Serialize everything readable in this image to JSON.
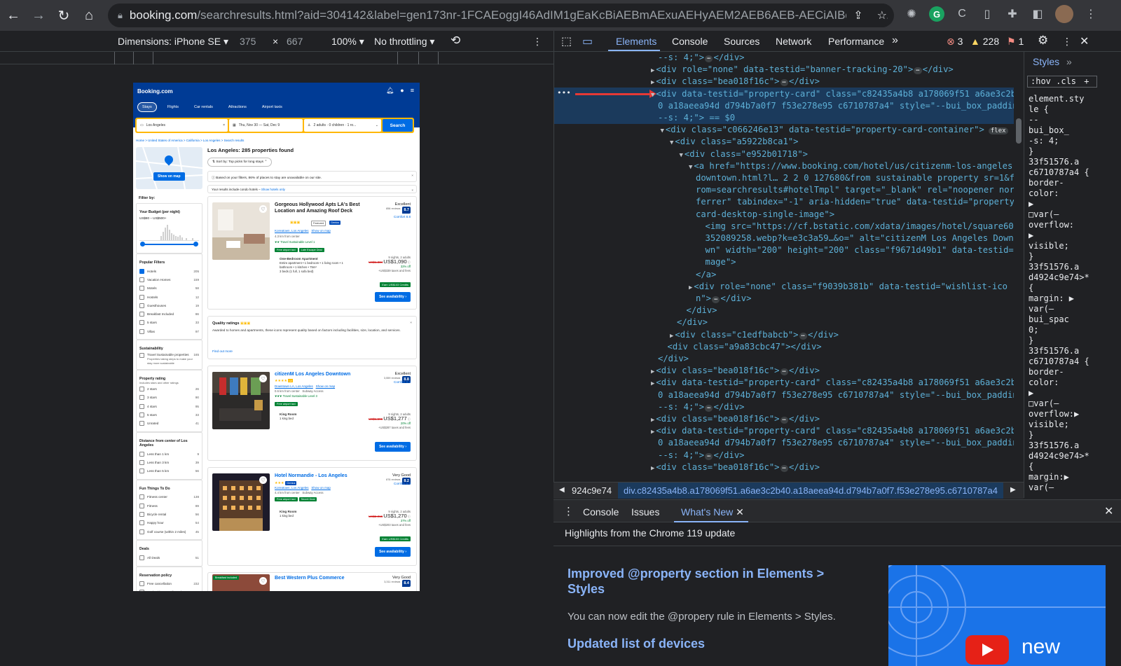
{
  "browser": {
    "url_host": "booking.com",
    "url_path": "/searchresults.html?aid=304142&label=gen173nr-1FCAEoggI46AdIM1gEaKcBiAEBmAExuAEHyAEM2AEB6AEB-AECiAIBqAIDu...",
    "ext_badge_letter": "G"
  },
  "device_toolbar": {
    "dimensions_label": "Dimensions: iPhone SE",
    "width": "375",
    "times": "×",
    "height": "667",
    "zoom": "100%",
    "throttling": "No throttling"
  },
  "booking": {
    "logo": "Booking.com",
    "tabs": [
      "Stays",
      "Flights",
      "Car rentals",
      "Attractions",
      "Airport taxis"
    ],
    "search": {
      "destination": "Los Angeles",
      "dates": "Thu, Nov 30 — Sat, Dec 9",
      "guests": "2 adults · 0 children · 1 ro...",
      "button": "Search"
    },
    "breadcrumbs": "Home > United States of America > California > Los Angeles > Search results",
    "show_on_map": "Show on map",
    "results_title": "Los Angeles: 285 properties found",
    "sort_label": "Sort by: Top picks for long stays",
    "notice": "Based on your filters, 86% of places to stay are unavailable on our site.",
    "notice2_text": "Your results include condo hotels –",
    "notice2_link": "Show hotels only",
    "filter_by": "Filter by:",
    "budget_title": "Your Budget (per night)",
    "budget_range": "US$80 – US$500+",
    "popular_title": "Popular Filters",
    "popular": [
      {
        "label": "Hotels",
        "count": "205",
        "on": true
      },
      {
        "label": "Vacation Homes",
        "count": "159",
        "on": false
      },
      {
        "label": "Motels",
        "count": "58",
        "on": false
      },
      {
        "label": "Hostels",
        "count": "12",
        "on": false
      },
      {
        "label": "Guesthouses",
        "count": "19",
        "on": false
      },
      {
        "label": "Breakfast Included",
        "count": "86",
        "on": false
      },
      {
        "label": "5 stars",
        "count": "33",
        "on": false
      },
      {
        "label": "Villas",
        "count": "97",
        "on": false
      }
    ],
    "sustain_title": "Sustainability",
    "sustain_label": "Travel Sustainable properties",
    "sustain_count": "165",
    "sustain_note": "Properties taking steps to make your stay more sustainable",
    "rating_title": "Property rating",
    "rating_note": "Includes stars and other ratings",
    "ratings": [
      {
        "label": "2 stars",
        "count": "26"
      },
      {
        "label": "3 stars",
        "count": "90"
      },
      {
        "label": "4 stars",
        "count": "95"
      },
      {
        "label": "5 stars",
        "count": "33"
      },
      {
        "label": "Unrated",
        "count": "41"
      }
    ],
    "distance_title": "Distance from center of Los Angeles",
    "distances": [
      {
        "label": "Less than 1 km",
        "count": "9"
      },
      {
        "label": "Less than 3 km",
        "count": "39"
      },
      {
        "label": "Less than 5 km",
        "count": "56"
      }
    ],
    "fun_title": "Fun Things To Do",
    "fun": [
      {
        "label": "Fitness center",
        "count": "138"
      },
      {
        "label": "Fitness",
        "count": "89"
      },
      {
        "label": "Bicycle rental",
        "count": "56"
      },
      {
        "label": "Happy hour",
        "count": "54"
      },
      {
        "label": "Golf course (within 2 miles)",
        "count": "45"
      }
    ],
    "deals_title": "Deals",
    "deals": [
      {
        "label": "All Deals",
        "count": "51"
      }
    ],
    "policy_title": "Reservation policy",
    "policy": [
      {
        "label": "Free cancellation",
        "count": "232"
      },
      {
        "label": "Book without credit card",
        "count": "1"
      }
    ],
    "quality": {
      "title": "Quality ratings",
      "body": "Awarded to homes and apartments, these icons represent quality based on factors including facilities, size, location, and services.",
      "link": "Find out more"
    },
    "cards": [
      {
        "name": "Gorgeous Hollywood Apts LA's Best Location and Amazing Roof Deck",
        "badges": "Featured",
        "location": "Koreatown, Los Angeles",
        "show_map": "Show on map",
        "distance": "4.3 km from center",
        "eco": "Travel Sustainable Level 1",
        "tags": [
          "Free airport taxi",
          "Late Escape Deal"
        ],
        "score_word": "Excellent",
        "reviews": "856 reviews",
        "score": "8.7",
        "comfort": "Comfort 8.8",
        "room_title": "One-Bedroom Apartment",
        "room_desc": "Entire apartment • 1 bedroom • 1 living room • 1 bathroom • 1 kitchen • 75m²",
        "room_beds": "3 beds (1 full, 1 sofa bed)",
        "nights": "9 nights, 2 adults",
        "old_price": "US$1,334",
        "price": "US$1,090",
        "discount": "32% off",
        "taxes": "+US$339 taxes and fees",
        "credit": "Earn US$103 Credits",
        "cta": "See availability"
      },
      {
        "name": "citizenM Los Angeles Downtown",
        "badges": "",
        "location": "Downtown LA, Los Angeles",
        "show_map": "Show on map",
        "distance": "0.6 km from center",
        "subway": "Subway Access",
        "eco": "Travel Sustainable Level 3",
        "tags": [
          "Free airport taxi"
        ],
        "score_word": "Excellent",
        "reviews": "3,559 reviews",
        "score": "8.8",
        "comfort": "Comfort 9.2",
        "room_title": "King Room",
        "room_desc": "1 king bed",
        "nights": "9 nights, 2 adults",
        "old_price": "US$1,596",
        "price": "US$1,277",
        "discount": "20% off",
        "taxes": "+US$287 taxes and fees",
        "credit": "",
        "cta": "See availability"
      },
      {
        "name": "Hotel Normandie - Los Angeles",
        "badges": "Genius",
        "location": "Koreatown, Los Angeles",
        "show_map": "Show on map",
        "distance": "4.4 km from center",
        "subway": "Subway Access",
        "eco": "",
        "tags": [
          "Free airport taxi",
          "Secret Deal"
        ],
        "score_word": "Very Good",
        "reviews": "876 reviews",
        "score": "8.2",
        "comfort": "Comfort 8.5",
        "room_title": "King Room",
        "room_desc": "1 king bed",
        "nights": "9 nights, 2 adults",
        "old_price": "US$2,016",
        "price": "US$1,270",
        "discount": "37% off",
        "taxes": "+US$203 taxes and fees",
        "credit": "Earn US$103 Credits",
        "cta": "See availability"
      },
      {
        "name": "Best Western Plus Commerce",
        "score_word": "Very Good",
        "reviews": "3,311 reviews",
        "score": "8.4",
        "tag_img": "Breakfast included"
      }
    ]
  },
  "devtools": {
    "tabs": [
      "Elements",
      "Console",
      "Sources",
      "Network",
      "Performance"
    ],
    "more": "»",
    "errors": "3",
    "warnings": "228",
    "issues": "1",
    "dom_lines": [
      {
        "indent": 0,
        "arrow": "",
        "html": "--s: 4;\">",
        "tail": "</div>"
      },
      {
        "indent": 0,
        "arrow": "▶",
        "open": "<div role=\"none\" data-testid=\"banner-tracking-20\">",
        "tail": "</div>"
      },
      {
        "indent": 0,
        "arrow": "▶",
        "open": "<div class=\"bea018f16c\">",
        "tail": "</div>"
      },
      {
        "indent": 0,
        "arrow": "▼",
        "open": "<div data-testid=\"property-card\" class=\"c82435a4b8 a178069f51 a6ae3c2b4",
        "tail": ""
      },
      {
        "indent": 0,
        "arrow": "",
        "open": "0 a18aeea94d d794b7a0f7 f53e278e95 c6710787a4\" style=\"--bui_box_padding",
        "tail": ""
      },
      {
        "indent": 0,
        "arrow": "",
        "open": "--s: 4;\"> == $0",
        "tail": ""
      },
      {
        "indent": 1,
        "arrow": "▼",
        "open": "<div class=\"c066246e13\" data-testid=\"property-card-container\">",
        "tail": "flex"
      },
      {
        "indent": 2,
        "arrow": "▼",
        "open": "<div class=\"a5922b8ca1\">",
        "tail": ""
      },
      {
        "indent": 3,
        "arrow": "▼",
        "open": "<div class=\"e952b01718\">",
        "tail": ""
      },
      {
        "indent": 4,
        "arrow": "▼",
        "open": "<a href=\"https://www.booking.com/hotel/us/citizenm-los-angeles-",
        "tail": ""
      },
      {
        "indent": 4,
        "arrow": "",
        "open": "downtown.html?l… 2 2 0  127680&from sustainable property sr=1&f",
        "tail": ""
      },
      {
        "indent": 4,
        "arrow": "",
        "open": "rom=searchresults#hotelTmpl\" target=\"_blank\" rel=\"noopener nore",
        "tail": ""
      },
      {
        "indent": 4,
        "arrow": "",
        "open": "ferrer\" tabindex=\"-1\" aria-hidden=\"true\" data-testid=\"property-",
        "tail": ""
      },
      {
        "indent": 4,
        "arrow": "",
        "open": "card-desktop-single-image\">",
        "tail": ""
      },
      {
        "indent": 5,
        "arrow": "",
        "open": "<img src=\"https://cf.bstatic.com/xdata/images/hotel/square600/",
        "tail": ""
      },
      {
        "indent": 5,
        "arrow": "",
        "open": "352089258.webp?k=e3c3a59…&o=\" alt=\"citizenM Los Angeles Downto",
        "tail": ""
      },
      {
        "indent": 5,
        "arrow": "",
        "open": "wn\" width=\"200\" height=\"200\" class=\"f9671d49b1\" data-testid=\"i",
        "tail": ""
      },
      {
        "indent": 5,
        "arrow": "",
        "open": "mage\">",
        "tail": ""
      },
      {
        "indent": 4,
        "arrow": "",
        "open": "</a>",
        "tail": ""
      },
      {
        "indent": 4,
        "arrow": "▶",
        "open": "<div role=\"none\" class=\"f9039b381b\" data-testid=\"wishlist-ico",
        "tail": ""
      },
      {
        "indent": 4,
        "arrow": "",
        "open": "n\">",
        "tail": "</div>"
      },
      {
        "indent": 3,
        "arrow": "",
        "open": "</div>",
        "tail": ""
      },
      {
        "indent": 2,
        "arrow": "",
        "open": "</div>",
        "tail": ""
      },
      {
        "indent": 2,
        "arrow": "▶",
        "open": "<div class=\"c1edfbabcb\">",
        "tail": "</div>"
      },
      {
        "indent": 1,
        "arrow": "",
        "open": "<div class=\"a9a83cbc47\"></div>",
        "tail": ""
      },
      {
        "indent": 0,
        "arrow": "",
        "open": "</div>",
        "tail": ""
      },
      {
        "indent": 0,
        "arrow": "▶",
        "open": "<div class=\"bea018f16c\">",
        "tail": "</div>"
      },
      {
        "indent": 0,
        "arrow": "▶",
        "open": "<div data-testid=\"property-card\" class=\"c82435a4b8 a178069f51 a6ae3c2b4",
        "tail": ""
      },
      {
        "indent": 0,
        "arrow": "",
        "open": "0 a18aeea94d d794b7a0f7 f53e278e95 c6710787a4\" style=\"--bui_box_padding",
        "tail": ""
      },
      {
        "indent": 0,
        "arrow": "",
        "open": "--s: 4;\">",
        "tail": "</div>"
      },
      {
        "indent": 0,
        "arrow": "▶",
        "open": "<div class=\"bea018f16c\">",
        "tail": "</div>"
      },
      {
        "indent": 0,
        "arrow": "▶",
        "open": "<div data-testid=\"property-card\" class=\"c82435a4b8 a178069f51 a6ae3c2b4",
        "tail": ""
      },
      {
        "indent": 0,
        "arrow": "",
        "open": "0 a18aeea94d d794b7a0f7 f53e278e95 c6710787a4\" style=\"--bui_box_padding",
        "tail": ""
      },
      {
        "indent": 0,
        "arrow": "",
        "open": "--s: 4;\">",
        "tail": "</div>"
      },
      {
        "indent": 0,
        "arrow": "▶",
        "open": "<div class=\"bea018f16c\">",
        "tail": "</div>"
      }
    ],
    "styles_tab": "Styles",
    "styles_more": "»",
    "styles_filter": ":hov  .cls",
    "styles_lines": [
      "element.sty",
      "le {",
      "  --",
      "  bui_box_",
      "  -s: 4;",
      "}",
      "33f51576.a",
      "c6710787a4 {",
      "  border-",
      "  color:",
      "  ▶",
      "  □var(—",
      "  overflow:",
      "  ▶",
      "  visible;",
      "}",
      "33f51576.a",
      "d4924c9e74>*",
      "{",
      "  margin: ▶",
      "  var(—",
      "  bui_spac",
      "  0;",
      "}",
      "33f51576.a",
      "c6710787a4 {",
      "  border-",
      "  color:",
      "  ▶",
      "  □var(—",
      "  overflow:▶",
      "  visible;",
      "}",
      "33f51576.a",
      "d4924c9e74>*",
      "{",
      "  margin:▶",
      "  var(—"
    ],
    "breadcrumb_left": "924c9e74",
    "breadcrumb_main": "div.c82435a4b8.a178069f51.a6ae3c2b40.a18aeea94d.d794b7a0f7.f53e278e95.c6710787a4",
    "drawer_tabs": [
      "Console",
      "Issues",
      "What's New"
    ],
    "drawer_heading": "Highlights from the Chrome 119 update",
    "wn1_title": "Improved @property section in Elements > Styles",
    "wn1_body": "You can now edit the @propery rule in Elements > Styles.",
    "wn2_title": "Updated list of devices",
    "video_word": "new"
  }
}
